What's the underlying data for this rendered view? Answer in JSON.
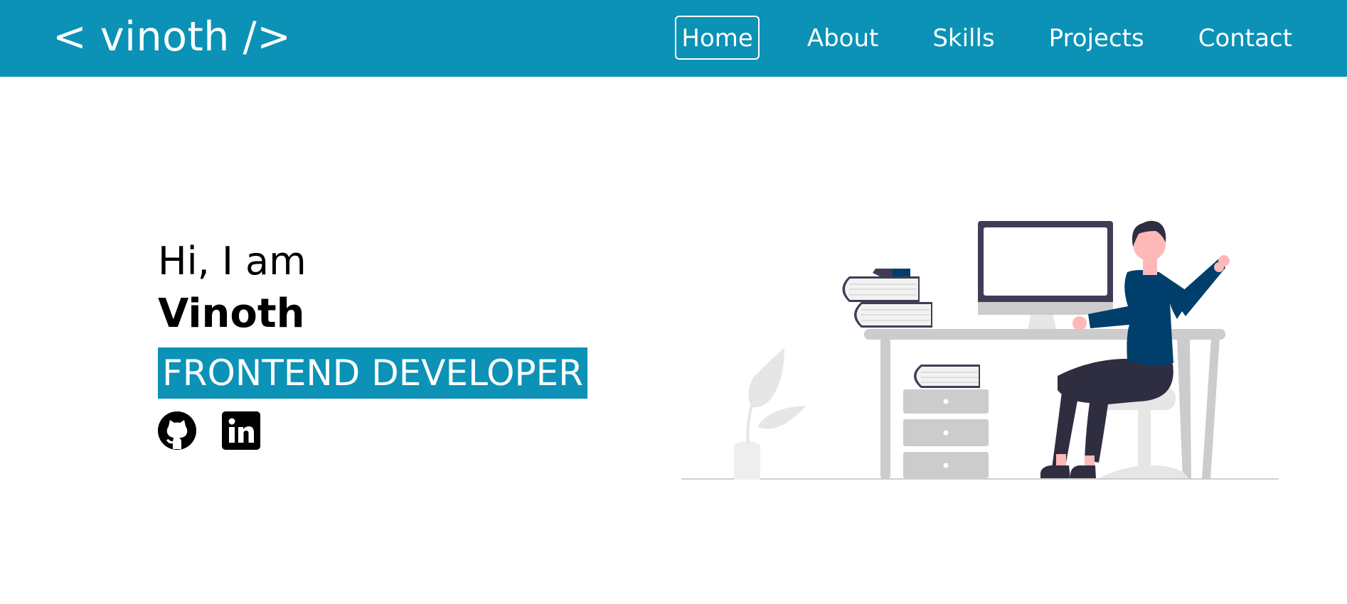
{
  "header": {
    "logo": "< vinoth />",
    "nav": [
      {
        "label": "Home",
        "active": true
      },
      {
        "label": "About",
        "active": false
      },
      {
        "label": "Skills",
        "active": false
      },
      {
        "label": "Projects",
        "active": false
      },
      {
        "label": "Contact",
        "active": false
      }
    ]
  },
  "hero": {
    "greeting": "Hi, I am",
    "name": "Vinoth",
    "role": "FRONTEND DEVELOPER",
    "socials": [
      {
        "icon": "github-icon"
      },
      {
        "icon": "linkedin-icon"
      }
    ]
  },
  "illustration": {
    "icon": "developer-at-desk-illustration"
  },
  "colors": {
    "accent": "#0b92b6",
    "text": "#000000",
    "background": "#ffffff",
    "illustration_navy": "#003e6b",
    "illustration_gray": "#cccccc"
  }
}
